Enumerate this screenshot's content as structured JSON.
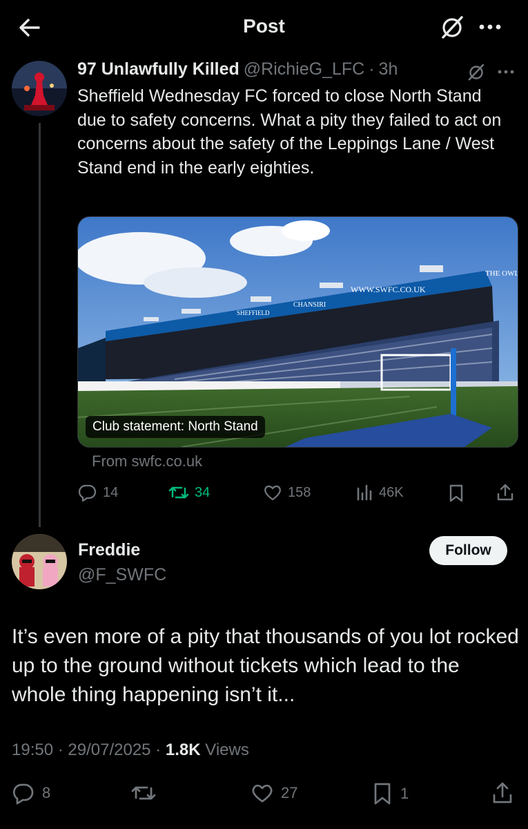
{
  "header": {
    "title": "Post"
  },
  "quoted_post": {
    "display_name": "97 Unlawfully Killed",
    "handle": "@RichieG_LFC",
    "separator": "·",
    "time": "3h",
    "text": "Sheffield Wednesday FC forced to close North Stand due to safety concerns. What a pity they failed to act on concerns about the safety of the Leppings Lane / West Stand end in the early eighties.",
    "card": {
      "caption": "Club statement: North Stand",
      "source": "From swfc.co.uk",
      "image_texts": {
        "sign1": "WWW.SWFC.CO.UK",
        "sign2": "THE OWLS",
        "sign3": "CHANSIRI",
        "sign4": "SHEFFIELD"
      }
    },
    "stats": {
      "replies": "14",
      "reposts": "34",
      "likes": "158",
      "views": "46K"
    }
  },
  "reply_post": {
    "display_name": "Freddie",
    "handle": "@F_SWFC",
    "follow_label": "Follow",
    "text": "It’s even more of a pity that thousands of you lot rocked up to the ground without tickets which lead to the whole thing happening isn’t it...",
    "time": "19:50",
    "date": "29/07/2025",
    "views_count": "1.8K",
    "views_label": "Views",
    "stats": {
      "replies": "8",
      "likes": "27",
      "bookmarks": "1"
    }
  },
  "colors": {
    "background": "#000000",
    "text": "#e7e9ea",
    "muted": "#71767b",
    "repost_active": "#00ba7c",
    "divider": "#2f3336"
  }
}
